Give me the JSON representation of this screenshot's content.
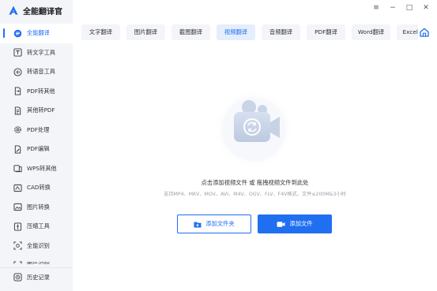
{
  "app": {
    "title": "全能翻译官",
    "brand_color": "#1f6ff0"
  },
  "window_controls": {
    "menu": "≡",
    "minimize": "−",
    "maximize": "□",
    "close": "✕"
  },
  "sidebar": {
    "items": [
      {
        "label": "全能翻译",
        "icon": "translate-icon",
        "active": true
      },
      {
        "label": "转文字工具",
        "icon": "text-convert-icon"
      },
      {
        "label": "转语音工具",
        "icon": "voice-icon"
      },
      {
        "label": "PDF转其他",
        "icon": "pdf-export-icon"
      },
      {
        "label": "其他转PDF",
        "icon": "pdf-import-icon"
      },
      {
        "label": "PDF处理",
        "icon": "gear-icon"
      },
      {
        "label": "PDF编辑",
        "icon": "pdf-edit-icon"
      },
      {
        "label": "WPS转其他",
        "icon": "wps-icon"
      },
      {
        "label": "CAD转换",
        "icon": "cad-icon"
      },
      {
        "label": "图片转换",
        "icon": "image-icon"
      },
      {
        "label": "压缩工具",
        "icon": "compress-icon"
      },
      {
        "label": "全能识别",
        "icon": "scan-icon"
      },
      {
        "label": "图片识别",
        "icon": "image-scan-icon"
      }
    ],
    "history": {
      "label": "历史记录",
      "icon": "history-icon"
    }
  },
  "tabs": [
    {
      "label": "文字翻译"
    },
    {
      "label": "图片翻译"
    },
    {
      "label": "截图翻译"
    },
    {
      "label": "视频翻译",
      "active": true
    },
    {
      "label": "音频翻译"
    },
    {
      "label": "PDF翻译"
    },
    {
      "label": "Word翻译"
    },
    {
      "label": "Excel翻译"
    }
  ],
  "main": {
    "hint": "点击添加视频文件 或 拖拽视频文件到此处",
    "formats": "支持MP4、MKV、MOV、AVI、M4V、OGV、FLV、F4V格式，文件≤200M&3小时",
    "add_folder_label": "添加文件夹",
    "add_file_label": "添加文件"
  }
}
